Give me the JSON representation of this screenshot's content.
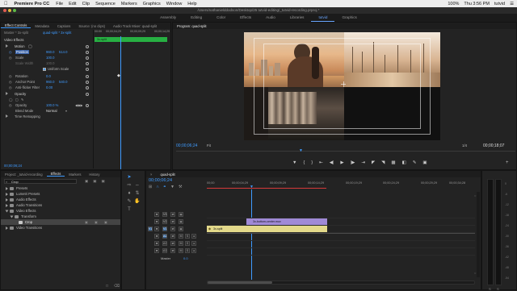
{
  "menubar": {
    "app_name": "Premiere Pro CC",
    "items": [
      "File",
      "Edit",
      "Clip",
      "Sequence",
      "Markers",
      "Graphics",
      "Window",
      "Help"
    ],
    "right_items": [
      "100%",
      "Thu 3:56 PM",
      "tutvid"
    ]
  },
  "titlebar": {
    "title": "/Users/nathanielddodson/Desktop/25 tutvid-editing/_tutvid-recording.prproj *"
  },
  "workspaces": [
    "Assembly",
    "Editing",
    "Color",
    "Effects",
    "Audio",
    "Libraries",
    "tutvid",
    "Graphics"
  ],
  "workspaces_active": "tutvid",
  "effect_controls": {
    "tabs": [
      "Effect Controls",
      "Metadata",
      "Captions",
      "Source: (no clips)",
      "Audio Track Mixer: quad-split"
    ],
    "source_label": "Master * 3x-split",
    "clip_label": "quad-split * 3x-split",
    "ruler": {
      "start": "00:00",
      "t1": "00;00;04;29",
      "t2": "00;00;09;29",
      "t3": "00;00;14;29"
    },
    "clip_bar": "3x-split",
    "section": "Video Effects",
    "rows": [
      {
        "label": "Motion",
        "value": ""
      },
      {
        "label": "Position",
        "value": "960.0",
        "value2": "514.0"
      },
      {
        "label": "Scale",
        "value": "100.0",
        "value2": ""
      },
      {
        "label": "Scale Width",
        "value": "100.0",
        "value2": ""
      },
      {
        "label": "Uniform Scale",
        "value": "",
        "value2": ""
      },
      {
        "label": "Rotation",
        "value": "0.0",
        "value2": ""
      },
      {
        "label": "Anchor Point",
        "value": "960.0",
        "value2": "540.0"
      },
      {
        "label": "Anti-flicker Filter",
        "value": "0.00",
        "value2": ""
      },
      {
        "label": "Opacity",
        "value": "",
        "value2": ""
      },
      {
        "label": "Opacity",
        "value": "100.0 %",
        "value2": ""
      },
      {
        "label": "Blend Mode",
        "value": "Normal",
        "value2": ""
      },
      {
        "label": "Time Remapping",
        "value": "",
        "value2": ""
      }
    ],
    "timecode": "00;00;06;24"
  },
  "program": {
    "tab": "Program: quad-split",
    "timecode_left": "00;00;06;24",
    "fit": "Fit",
    "ratio": "1/4",
    "timecode_right": "00;00;18;07"
  },
  "project": {
    "tabs": [
      "Project: _tutvid-recording",
      "Effects",
      "Markers",
      "History"
    ],
    "search_value": "Crop",
    "items": [
      {
        "label": "Presets",
        "indent": 0
      },
      {
        "label": "Lumetri Presets",
        "indent": 0
      },
      {
        "label": "Audio Effects",
        "indent": 0
      },
      {
        "label": "Audio Transitions",
        "indent": 0
      },
      {
        "label": "Video Effects",
        "indent": 0
      },
      {
        "label": "Transform",
        "indent": 1
      },
      {
        "label": "Crop",
        "indent": 2
      },
      {
        "label": "Video Transitions",
        "indent": 0
      }
    ]
  },
  "timeline": {
    "tab": "quad-split",
    "timecode": "00;00;06;24",
    "ruler": [
      "00;00",
      "00;00;04;29",
      "00;00;09;29",
      "00;00;14;29",
      "00;00;19;29",
      "00;00;24;29",
      "00;00;29;29",
      "00;00;34;28"
    ],
    "tracks": [
      "V3",
      "V2",
      "V1",
      "A1",
      "A2",
      "A3",
      "Master"
    ],
    "master_value": "0.0",
    "clips": [
      {
        "label": "3x-bottom-center.mov",
        "track": "V2",
        "color": "#a08ad6"
      },
      {
        "label": "3x-split",
        "track": "V1",
        "color": "#e3d98a"
      },
      {
        "label": "",
        "track": "V1b",
        "color": "#cfcfcf"
      }
    ]
  },
  "colors": {
    "accent": "#3f9bff",
    "panel": "#232323"
  }
}
